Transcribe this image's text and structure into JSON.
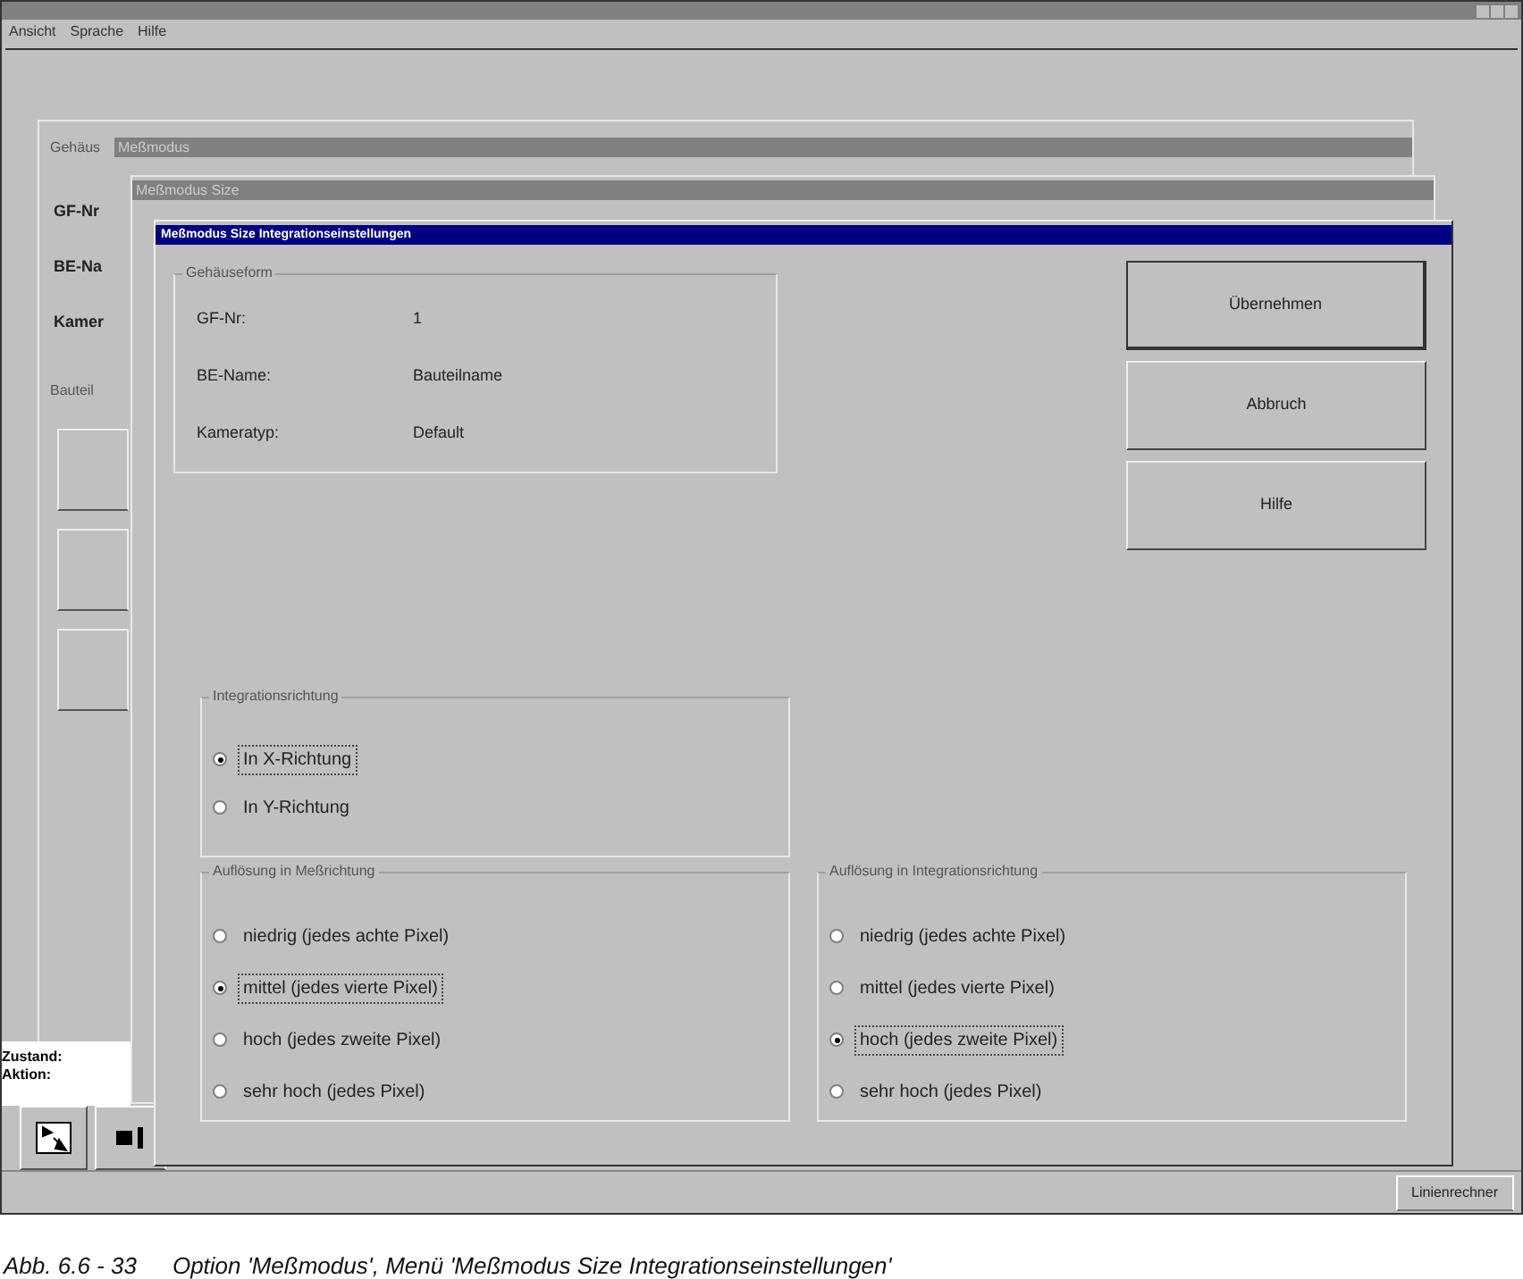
{
  "menu": [
    {
      "label": "Ansicht"
    },
    {
      "label": "Sprache"
    },
    {
      "label": "Hilfe"
    }
  ],
  "background_windows": [
    {
      "title": "Meßmodus",
      "group_label": "Gehäus",
      "labels": [
        "GF-Nr",
        "BE-Na",
        "Kamer"
      ],
      "group2_label": "Bauteil"
    },
    {
      "title": "Meßmodus Size"
    }
  ],
  "dialog": {
    "title": "Meßmodus Size Integrationseinstellungen",
    "info_group": {
      "title": "Gehäuseform",
      "rows": [
        {
          "label": "GF-Nr:",
          "value": "1"
        },
        {
          "label": "BE-Name:",
          "value": "Bauteilname"
        },
        {
          "label": "Kameratyp:",
          "value": "Default"
        }
      ]
    },
    "buttons": [
      {
        "label": "Übernehmen",
        "default": true
      },
      {
        "label": "Abbruch",
        "default": false
      },
      {
        "label": "Hilfe",
        "default": false
      }
    ],
    "direction_group": {
      "title": "Integrationsrichtung",
      "options": [
        {
          "label": "In X-Richtung",
          "selected": true
        },
        {
          "label": "In Y-Richtung",
          "selected": false
        }
      ]
    },
    "resolution_groups": [
      {
        "title": "Auflösung in Meßrichtung",
        "options": [
          {
            "label": "niedrig (jedes achte Pixel)",
            "selected": false
          },
          {
            "label": "mittel (jedes vierte Pixel)",
            "selected": true
          },
          {
            "label": "hoch (jedes zweite Pixel)",
            "selected": false
          },
          {
            "label": "sehr hoch (jedes Pixel)",
            "selected": false
          }
        ]
      },
      {
        "title": "Auflösung in Integrationsrichtung",
        "options": [
          {
            "label": "niedrig (jedes achte Pixel)",
            "selected": false
          },
          {
            "label": "mittel (jedes vierte Pixel)",
            "selected": false
          },
          {
            "label": "hoch (jedes zweite Pixel)",
            "selected": true
          },
          {
            "label": "sehr hoch (jedes Pixel)",
            "selected": false
          }
        ]
      }
    ]
  },
  "status": {
    "state_label": "Zustand:",
    "action_label": "Aktion:",
    "mode": "Linienrechner"
  },
  "caption": {
    "number": "Abb. 6.6 - 33",
    "text": "Option 'Meßmodus', Menü 'Meßmodus Size Integrationseinstellungen'"
  }
}
